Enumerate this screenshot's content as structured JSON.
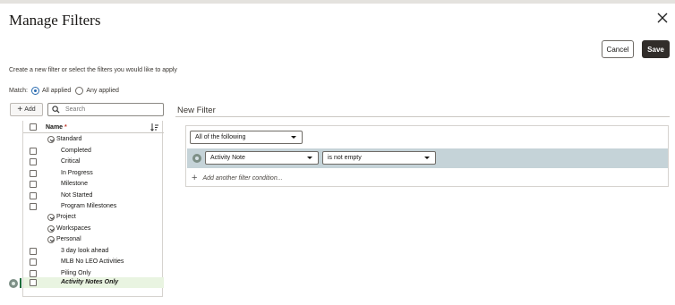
{
  "dialog": {
    "title": "Manage Filters",
    "close_icon": "close-icon"
  },
  "actions": {
    "cancel_label": "Cancel",
    "save_label": "Save"
  },
  "instructions": "Create a new filter or select the filters you would like to apply",
  "match": {
    "label": "Match:",
    "options": [
      {
        "label": "All applied",
        "selected": true
      },
      {
        "label": "Any applied",
        "selected": false
      }
    ]
  },
  "toolbar": {
    "add_label": "Add",
    "search_placeholder": "Search"
  },
  "list": {
    "header": "Name",
    "required_marker": "*",
    "rows": [
      {
        "label": "Standard",
        "kind": "group",
        "expanded": true
      },
      {
        "label": "Completed",
        "kind": "item",
        "checked": false
      },
      {
        "label": "Critical",
        "kind": "item",
        "checked": false
      },
      {
        "label": "In Progress",
        "kind": "item",
        "checked": false
      },
      {
        "label": "Milestone",
        "kind": "item",
        "checked": false
      },
      {
        "label": "Not Started",
        "kind": "item",
        "checked": false
      },
      {
        "label": "Program Milestones",
        "kind": "item",
        "checked": false
      },
      {
        "label": "Project",
        "kind": "group",
        "expanded": false
      },
      {
        "label": "Workspaces",
        "kind": "group",
        "expanded": false
      },
      {
        "label": "Personal",
        "kind": "group",
        "expanded": true
      },
      {
        "label": "3 day look ahead",
        "kind": "item",
        "checked": false
      },
      {
        "label": "MLB No LEO Activities",
        "kind": "item",
        "checked": false
      },
      {
        "label": "Piling Only",
        "kind": "item",
        "checked": false
      },
      {
        "label": "Activity Notes Only",
        "kind": "item",
        "checked": false,
        "selected": true
      }
    ]
  },
  "new_filter": {
    "heading": "New Filter",
    "match_mode": "All of the following",
    "conditions": [
      {
        "field": "Activity Note",
        "operator": "is not empty"
      }
    ],
    "add_condition_label": "Add another filter condition..."
  },
  "colors": {
    "save_bg": "#312d2a",
    "condition_row_bg": "#c5d3d8",
    "selected_row_bg": "#e9f4e1",
    "selected_marker": "#1d6e3b"
  }
}
